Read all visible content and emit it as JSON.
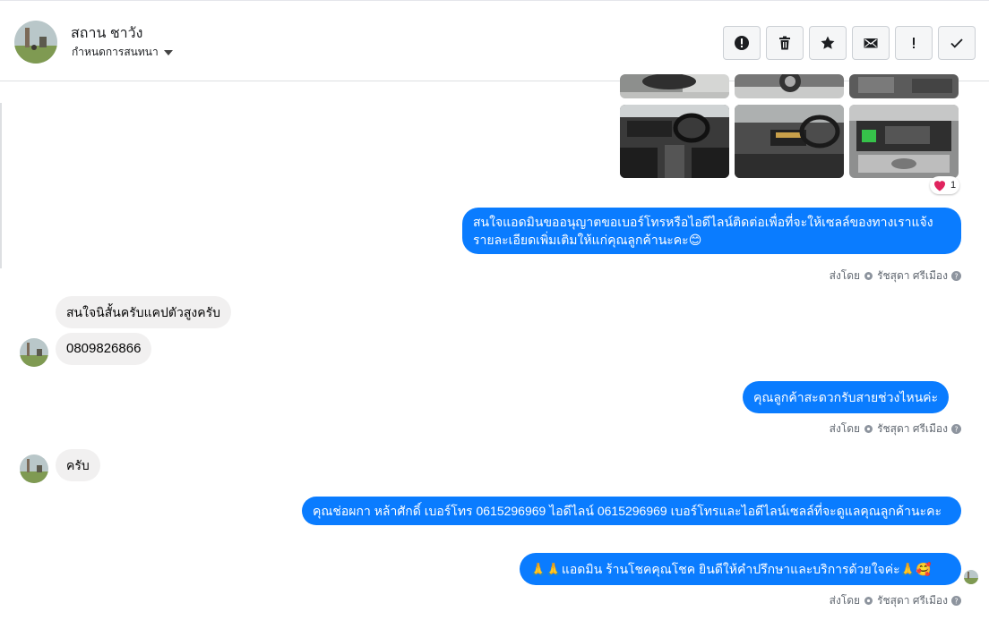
{
  "header": {
    "contact_name": "สถาน ชาวัง",
    "conversation_label": "กำหนดการสนทนา",
    "actions": [
      {
        "name": "report-button",
        "icon": "alert-circle-icon"
      },
      {
        "name": "delete-button",
        "icon": "trash-icon"
      },
      {
        "name": "star-button",
        "icon": "star-icon"
      },
      {
        "name": "mark-unread-button",
        "icon": "envelope-icon"
      },
      {
        "name": "important-button",
        "icon": "exclamation-icon"
      },
      {
        "name": "done-button",
        "icon": "check-icon"
      }
    ]
  },
  "photos": {
    "reaction": {
      "emoji": "heart",
      "count": "1"
    }
  },
  "messages": [
    {
      "id": "m1",
      "direction": "outgoing",
      "text": "สนใจแอดมินขออนุญาตขอเบอร์โทรหรือไอดีไลน์ติดต่อเพื่อที่จะให้เซลล์ของทางเราแจ้งรายละเอียดเพิ่มเติมให้แก่คุณลูกค้านะคะ😊"
    },
    {
      "id": "m2",
      "direction": "incoming",
      "text": "สนใจนิสั้นครับแคปตัวสูงครับ"
    },
    {
      "id": "m3",
      "direction": "incoming",
      "text": "0809826866"
    },
    {
      "id": "m4",
      "direction": "outgoing",
      "text": "คุณลูกค้าสะดวกรับสายช่วงไหนค่ะ"
    },
    {
      "id": "m5",
      "direction": "incoming",
      "text": "ครับ"
    },
    {
      "id": "m6",
      "direction": "outgoing",
      "text": "คุณช่อผกา หล้าศักดิ์       เบอร์โทร 0615296969  ไอดีไลน์ 0615296969   เบอร์โทรและไอดีไลน์เซลล์ที่จะดูแลคุณลูกค้านะคะ"
    },
    {
      "id": "m7",
      "direction": "outgoing",
      "text": "🙏🙏แอดมิน ร้านโชคคุณโชค ยินดีให้คำปรึกษาและบริการด้วยใจค่ะ🙏🥰"
    }
  ],
  "sent_by": {
    "prefix": "ส่งโดย",
    "name": "รัชสุดา ศรีเมือง"
  },
  "colors": {
    "outgoing_bubble": "#0a7cff",
    "incoming_bubble": "#f1f0f0",
    "meta_text": "#606770"
  }
}
